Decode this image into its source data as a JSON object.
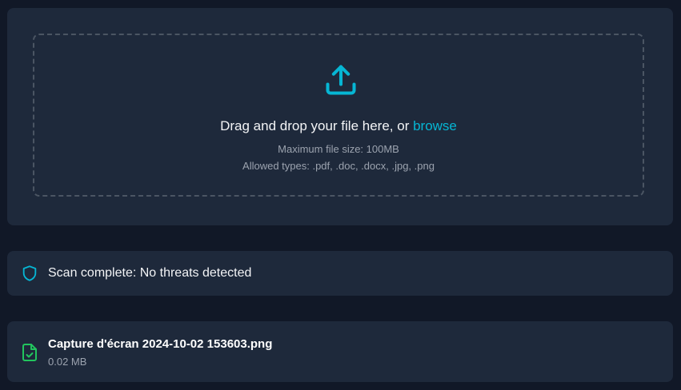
{
  "upload": {
    "icon": "upload-icon",
    "drop_text": "Drag and drop your file here, or ",
    "browse_label": "browse",
    "max_size_text": "Maximum file size: 100MB",
    "allowed_types_text": "Allowed types: .pdf, .doc, .docx, .jpg, .png"
  },
  "scan": {
    "icon": "shield-icon",
    "status_text": "Scan complete: No threats detected"
  },
  "file": {
    "icon": "file-check-icon",
    "name": "Capture d'écran 2024-10-02 153603.png",
    "size": "0.02 MB"
  },
  "colors": {
    "background": "#111827",
    "card": "#1e293b",
    "accent": "#06b6d4",
    "success": "#22c55e",
    "muted_text": "#9ca3af"
  }
}
